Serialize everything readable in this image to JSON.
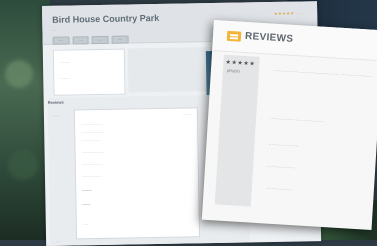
{
  "window": {
    "title": "Bird House Country Park",
    "subtitle": "····",
    "rating_stars": "★★★★★ ·····",
    "tabs": [
      "····",
      "····",
      "····",
      "····"
    ]
  },
  "left_column": {
    "line1": "········",
    "line2": "········"
  },
  "reviews_panel": {
    "label": "Reviews",
    "button": "········",
    "row_label": "········",
    "card_meta": "··· ·····",
    "card_lines": [
      "······················",
      "·······················",
      "····················",
      "······················",
      "·····················",
      "···················"
    ],
    "card_bold": "··········",
    "card_bold2": "········",
    "card_end": "·····"
  },
  "bottom_tag": "·····",
  "zoom_card": {
    "title": "REVIEWS",
    "stars": "★★★★★",
    "reviewer": "pRoBG",
    "paragraphs": [
      "················· ·························· ·····················",
      "···················· ···············",
      "····················",
      "···················",
      "··················"
    ]
  },
  "colors": {
    "accent_blue": "#3f6fa8",
    "star_orange": "#e4a23b",
    "review_icon": "#f2b53a"
  }
}
